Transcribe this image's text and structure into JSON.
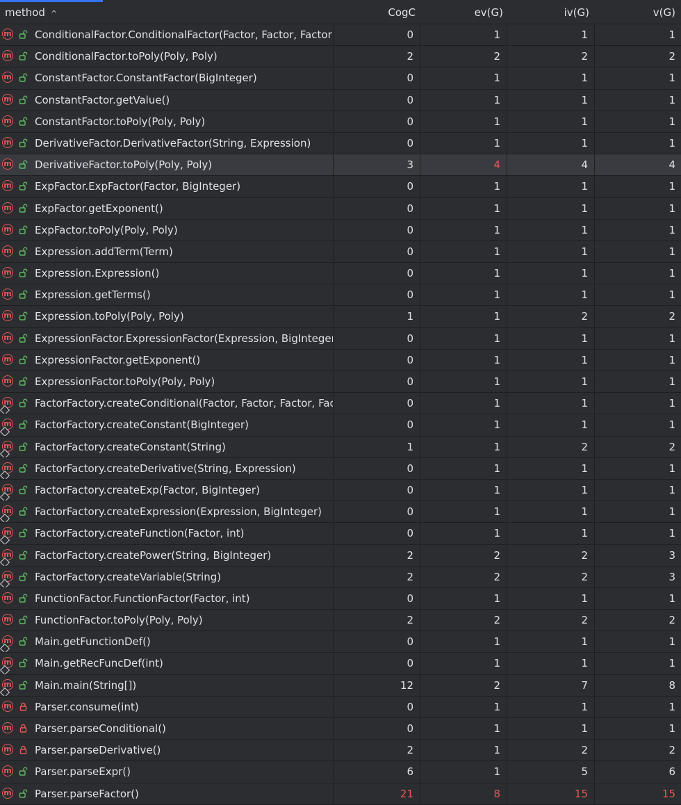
{
  "header": {
    "method": "method",
    "sort_indicator": "^",
    "cogc": "CogC",
    "ev": "ev(G)",
    "iv": "iv(G)",
    "v": "v(G)"
  },
  "colors": {
    "background": "#2b2d30",
    "selected_row": "#393b40",
    "grid_line": "#1e1f22",
    "text": "#dfe1e5",
    "warning": "#e55b57",
    "method_icon": "#e55b57",
    "public_icon": "#5fb865",
    "private_icon": "#e55b57",
    "accent": "#3574f0"
  },
  "rows": [
    {
      "method": "ConditionalFactor.ConditionalFactor(Factor, Factor, Factor,",
      "cogc": "0",
      "ev": "1",
      "iv": "1",
      "v": "1",
      "visibility": "public",
      "static": false,
      "selected": false
    },
    {
      "method": "ConditionalFactor.toPoly(Poly, Poly)",
      "cogc": "2",
      "ev": "2",
      "iv": "2",
      "v": "2",
      "visibility": "public",
      "static": false,
      "selected": false
    },
    {
      "method": "ConstantFactor.ConstantFactor(BigInteger)",
      "cogc": "0",
      "ev": "1",
      "iv": "1",
      "v": "1",
      "visibility": "public",
      "static": false,
      "selected": false
    },
    {
      "method": "ConstantFactor.getValue()",
      "cogc": "0",
      "ev": "1",
      "iv": "1",
      "v": "1",
      "visibility": "public",
      "static": false,
      "selected": false
    },
    {
      "method": "ConstantFactor.toPoly(Poly, Poly)",
      "cogc": "0",
      "ev": "1",
      "iv": "1",
      "v": "1",
      "visibility": "public",
      "static": false,
      "selected": false
    },
    {
      "method": "DerivativeFactor.DerivativeFactor(String, Expression)",
      "cogc": "0",
      "ev": "1",
      "iv": "1",
      "v": "1",
      "visibility": "public",
      "static": false,
      "selected": false
    },
    {
      "method": "DerivativeFactor.toPoly(Poly, Poly)",
      "cogc": "3",
      "ev": "4",
      "iv": "4",
      "v": "4",
      "visibility": "public",
      "static": false,
      "selected": true,
      "ev_bad": true
    },
    {
      "method": "ExpFactor.ExpFactor(Factor, BigInteger)",
      "cogc": "0",
      "ev": "1",
      "iv": "1",
      "v": "1",
      "visibility": "public",
      "static": false,
      "selected": false
    },
    {
      "method": "ExpFactor.getExponent()",
      "cogc": "0",
      "ev": "1",
      "iv": "1",
      "v": "1",
      "visibility": "public",
      "static": false,
      "selected": false
    },
    {
      "method": "ExpFactor.toPoly(Poly, Poly)",
      "cogc": "0",
      "ev": "1",
      "iv": "1",
      "v": "1",
      "visibility": "public",
      "static": false,
      "selected": false
    },
    {
      "method": "Expression.addTerm(Term)",
      "cogc": "0",
      "ev": "1",
      "iv": "1",
      "v": "1",
      "visibility": "public",
      "static": false,
      "selected": false
    },
    {
      "method": "Expression.Expression()",
      "cogc": "0",
      "ev": "1",
      "iv": "1",
      "v": "1",
      "visibility": "public",
      "static": false,
      "selected": false
    },
    {
      "method": "Expression.getTerms()",
      "cogc": "0",
      "ev": "1",
      "iv": "1",
      "v": "1",
      "visibility": "public",
      "static": false,
      "selected": false
    },
    {
      "method": "Expression.toPoly(Poly, Poly)",
      "cogc": "1",
      "ev": "1",
      "iv": "2",
      "v": "2",
      "visibility": "public",
      "static": false,
      "selected": false
    },
    {
      "method": "ExpressionFactor.ExpressionFactor(Expression, BigInteger)",
      "cogc": "0",
      "ev": "1",
      "iv": "1",
      "v": "1",
      "visibility": "public",
      "static": false,
      "selected": false
    },
    {
      "method": "ExpressionFactor.getExponent()",
      "cogc": "0",
      "ev": "1",
      "iv": "1",
      "v": "1",
      "visibility": "public",
      "static": false,
      "selected": false
    },
    {
      "method": "ExpressionFactor.toPoly(Poly, Poly)",
      "cogc": "0",
      "ev": "1",
      "iv": "1",
      "v": "1",
      "visibility": "public",
      "static": false,
      "selected": false
    },
    {
      "method": "FactorFactory.createConditional(Factor, Factor, Factor, Fact",
      "cogc": "0",
      "ev": "1",
      "iv": "1",
      "v": "1",
      "visibility": "public",
      "static": true,
      "selected": false
    },
    {
      "method": "FactorFactory.createConstant(BigInteger)",
      "cogc": "0",
      "ev": "1",
      "iv": "1",
      "v": "1",
      "visibility": "public",
      "static": true,
      "selected": false
    },
    {
      "method": "FactorFactory.createConstant(String)",
      "cogc": "1",
      "ev": "1",
      "iv": "2",
      "v": "2",
      "visibility": "public",
      "static": true,
      "selected": false
    },
    {
      "method": "FactorFactory.createDerivative(String, Expression)",
      "cogc": "0",
      "ev": "1",
      "iv": "1",
      "v": "1",
      "visibility": "public",
      "static": true,
      "selected": false
    },
    {
      "method": "FactorFactory.createExp(Factor, BigInteger)",
      "cogc": "0",
      "ev": "1",
      "iv": "1",
      "v": "1",
      "visibility": "public",
      "static": true,
      "selected": false
    },
    {
      "method": "FactorFactory.createExpression(Expression, BigInteger)",
      "cogc": "0",
      "ev": "1",
      "iv": "1",
      "v": "1",
      "visibility": "public",
      "static": true,
      "selected": false
    },
    {
      "method": "FactorFactory.createFunction(Factor, int)",
      "cogc": "0",
      "ev": "1",
      "iv": "1",
      "v": "1",
      "visibility": "public",
      "static": true,
      "selected": false
    },
    {
      "method": "FactorFactory.createPower(String, BigInteger)",
      "cogc": "2",
      "ev": "2",
      "iv": "2",
      "v": "3",
      "visibility": "public",
      "static": true,
      "selected": false
    },
    {
      "method": "FactorFactory.createVariable(String)",
      "cogc": "2",
      "ev": "2",
      "iv": "2",
      "v": "3",
      "visibility": "public",
      "static": true,
      "selected": false
    },
    {
      "method": "FunctionFactor.FunctionFactor(Factor, int)",
      "cogc": "0",
      "ev": "1",
      "iv": "1",
      "v": "1",
      "visibility": "public",
      "static": false,
      "selected": false
    },
    {
      "method": "FunctionFactor.toPoly(Poly, Poly)",
      "cogc": "2",
      "ev": "2",
      "iv": "2",
      "v": "2",
      "visibility": "public",
      "static": false,
      "selected": false
    },
    {
      "method": "Main.getFunctionDef()",
      "cogc": "0",
      "ev": "1",
      "iv": "1",
      "v": "1",
      "visibility": "public",
      "static": true,
      "selected": false
    },
    {
      "method": "Main.getRecFuncDef(int)",
      "cogc": "0",
      "ev": "1",
      "iv": "1",
      "v": "1",
      "visibility": "public",
      "static": true,
      "selected": false
    },
    {
      "method": "Main.main(String[])",
      "cogc": "12",
      "ev": "2",
      "iv": "7",
      "v": "8",
      "visibility": "public",
      "static": true,
      "selected": false
    },
    {
      "method": "Parser.consume(int)",
      "cogc": "0",
      "ev": "1",
      "iv": "1",
      "v": "1",
      "visibility": "private",
      "static": false,
      "selected": false
    },
    {
      "method": "Parser.parseConditional()",
      "cogc": "0",
      "ev": "1",
      "iv": "1",
      "v": "1",
      "visibility": "private",
      "static": false,
      "selected": false
    },
    {
      "method": "Parser.parseDerivative()",
      "cogc": "2",
      "ev": "1",
      "iv": "2",
      "v": "2",
      "visibility": "private",
      "static": false,
      "selected": false
    },
    {
      "method": "Parser.parseExpr()",
      "cogc": "6",
      "ev": "1",
      "iv": "5",
      "v": "6",
      "visibility": "public",
      "static": false,
      "selected": false
    },
    {
      "method": "Parser.parseFactor()",
      "cogc": "21",
      "ev": "8",
      "iv": "15",
      "v": "15",
      "visibility": "public",
      "static": false,
      "selected": false,
      "cogc_bad": true,
      "ev_bad": true,
      "iv_bad": true,
      "v_bad": true
    }
  ]
}
